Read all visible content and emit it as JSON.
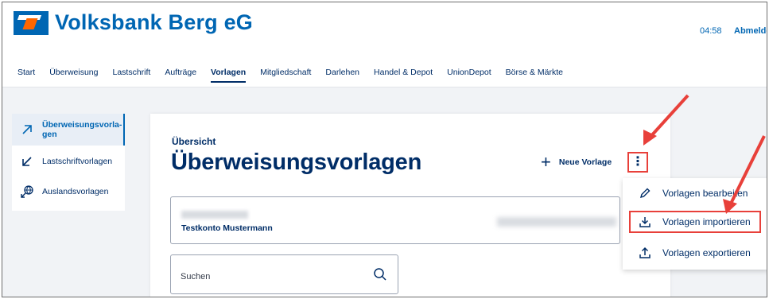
{
  "header": {
    "bank_name": "Volksbank Berg eG",
    "logo_icon": "vr-logo-icon",
    "time": "04:58",
    "logout_label": "Abmelde"
  },
  "nav": {
    "items": [
      {
        "label": "Start",
        "active": false
      },
      {
        "label": "Überweisung",
        "active": false
      },
      {
        "label": "Lastschrift",
        "active": false
      },
      {
        "label": "Aufträge",
        "active": false
      },
      {
        "label": "Vorlagen",
        "active": true
      },
      {
        "label": "Mitgliedschaft",
        "active": false
      },
      {
        "label": "Darlehen",
        "active": false
      },
      {
        "label": "Handel & Depot",
        "active": false
      },
      {
        "label": "UnionDepot",
        "active": false
      },
      {
        "label": "Börse & Märkte",
        "active": false
      }
    ]
  },
  "sidebar": {
    "items": [
      {
        "label_line1": "Überweisungsvorla-",
        "label_line2": "gen",
        "icon": "arrow-up-right-icon",
        "active": true
      },
      {
        "label": "Lastschriftvorlagen",
        "icon": "arrow-down-left-icon",
        "active": false
      },
      {
        "label": "Auslandsvorlagen",
        "icon": "globe-arrow-icon",
        "active": false
      }
    ]
  },
  "main": {
    "kicker": "Übersicht",
    "title": "Überweisungsvorlagen",
    "new_template_label": "Neue Vorlage",
    "more_icon": "kebab-menu-icon",
    "account_name": "Testkonto Mustermann",
    "search_placeholder": "Suchen"
  },
  "menu": {
    "items": [
      {
        "label": "Vorlagen bearbeiten",
        "icon": "pencil-icon"
      },
      {
        "label": "Vorlagen importieren",
        "icon": "download-icon"
      },
      {
        "label": "Vorlagen exportieren",
        "icon": "upload-icon"
      }
    ]
  },
  "colors": {
    "brand_blue": "#0066b3",
    "brand_orange": "#ff6600",
    "text_navy": "#002d67",
    "annotation_red": "#e8403a",
    "page_bg": "#f1f3f6"
  }
}
